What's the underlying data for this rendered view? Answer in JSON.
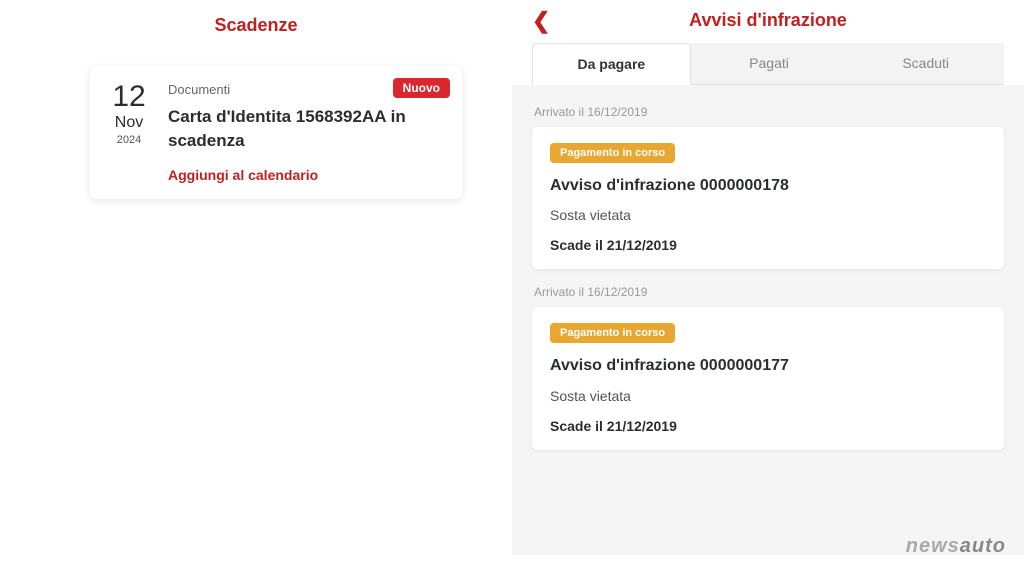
{
  "left": {
    "title": "Scadenze",
    "badge_new": "Nuovo",
    "deadline": {
      "day": "12",
      "month": "Nov",
      "year": "2024",
      "category": "Documenti",
      "heading": "Carta d'Identita 1568392AA in scadenza",
      "calendar_link": "Aggiungi al calendario"
    }
  },
  "right": {
    "title": "Avvisi d'infrazione",
    "tabs": {
      "to_pay": "Da pagare",
      "paid": "Pagati",
      "expired": "Scaduti"
    },
    "infractions": [
      {
        "arrived": "Arrivato il 16/12/2019",
        "payment_status": "Pagamento in corso",
        "title": "Avviso d'infrazione 0000000178",
        "reason": "Sosta vietata",
        "due": "Scade il 21/12/2019"
      },
      {
        "arrived": "Arrivato il 16/12/2019",
        "payment_status": "Pagamento in corso",
        "title": "Avviso d'infrazione 0000000177",
        "reason": "Sosta vietata",
        "due": "Scade il 21/12/2019"
      }
    ]
  },
  "watermark": {
    "part1": "news",
    "part2": "auto"
  }
}
